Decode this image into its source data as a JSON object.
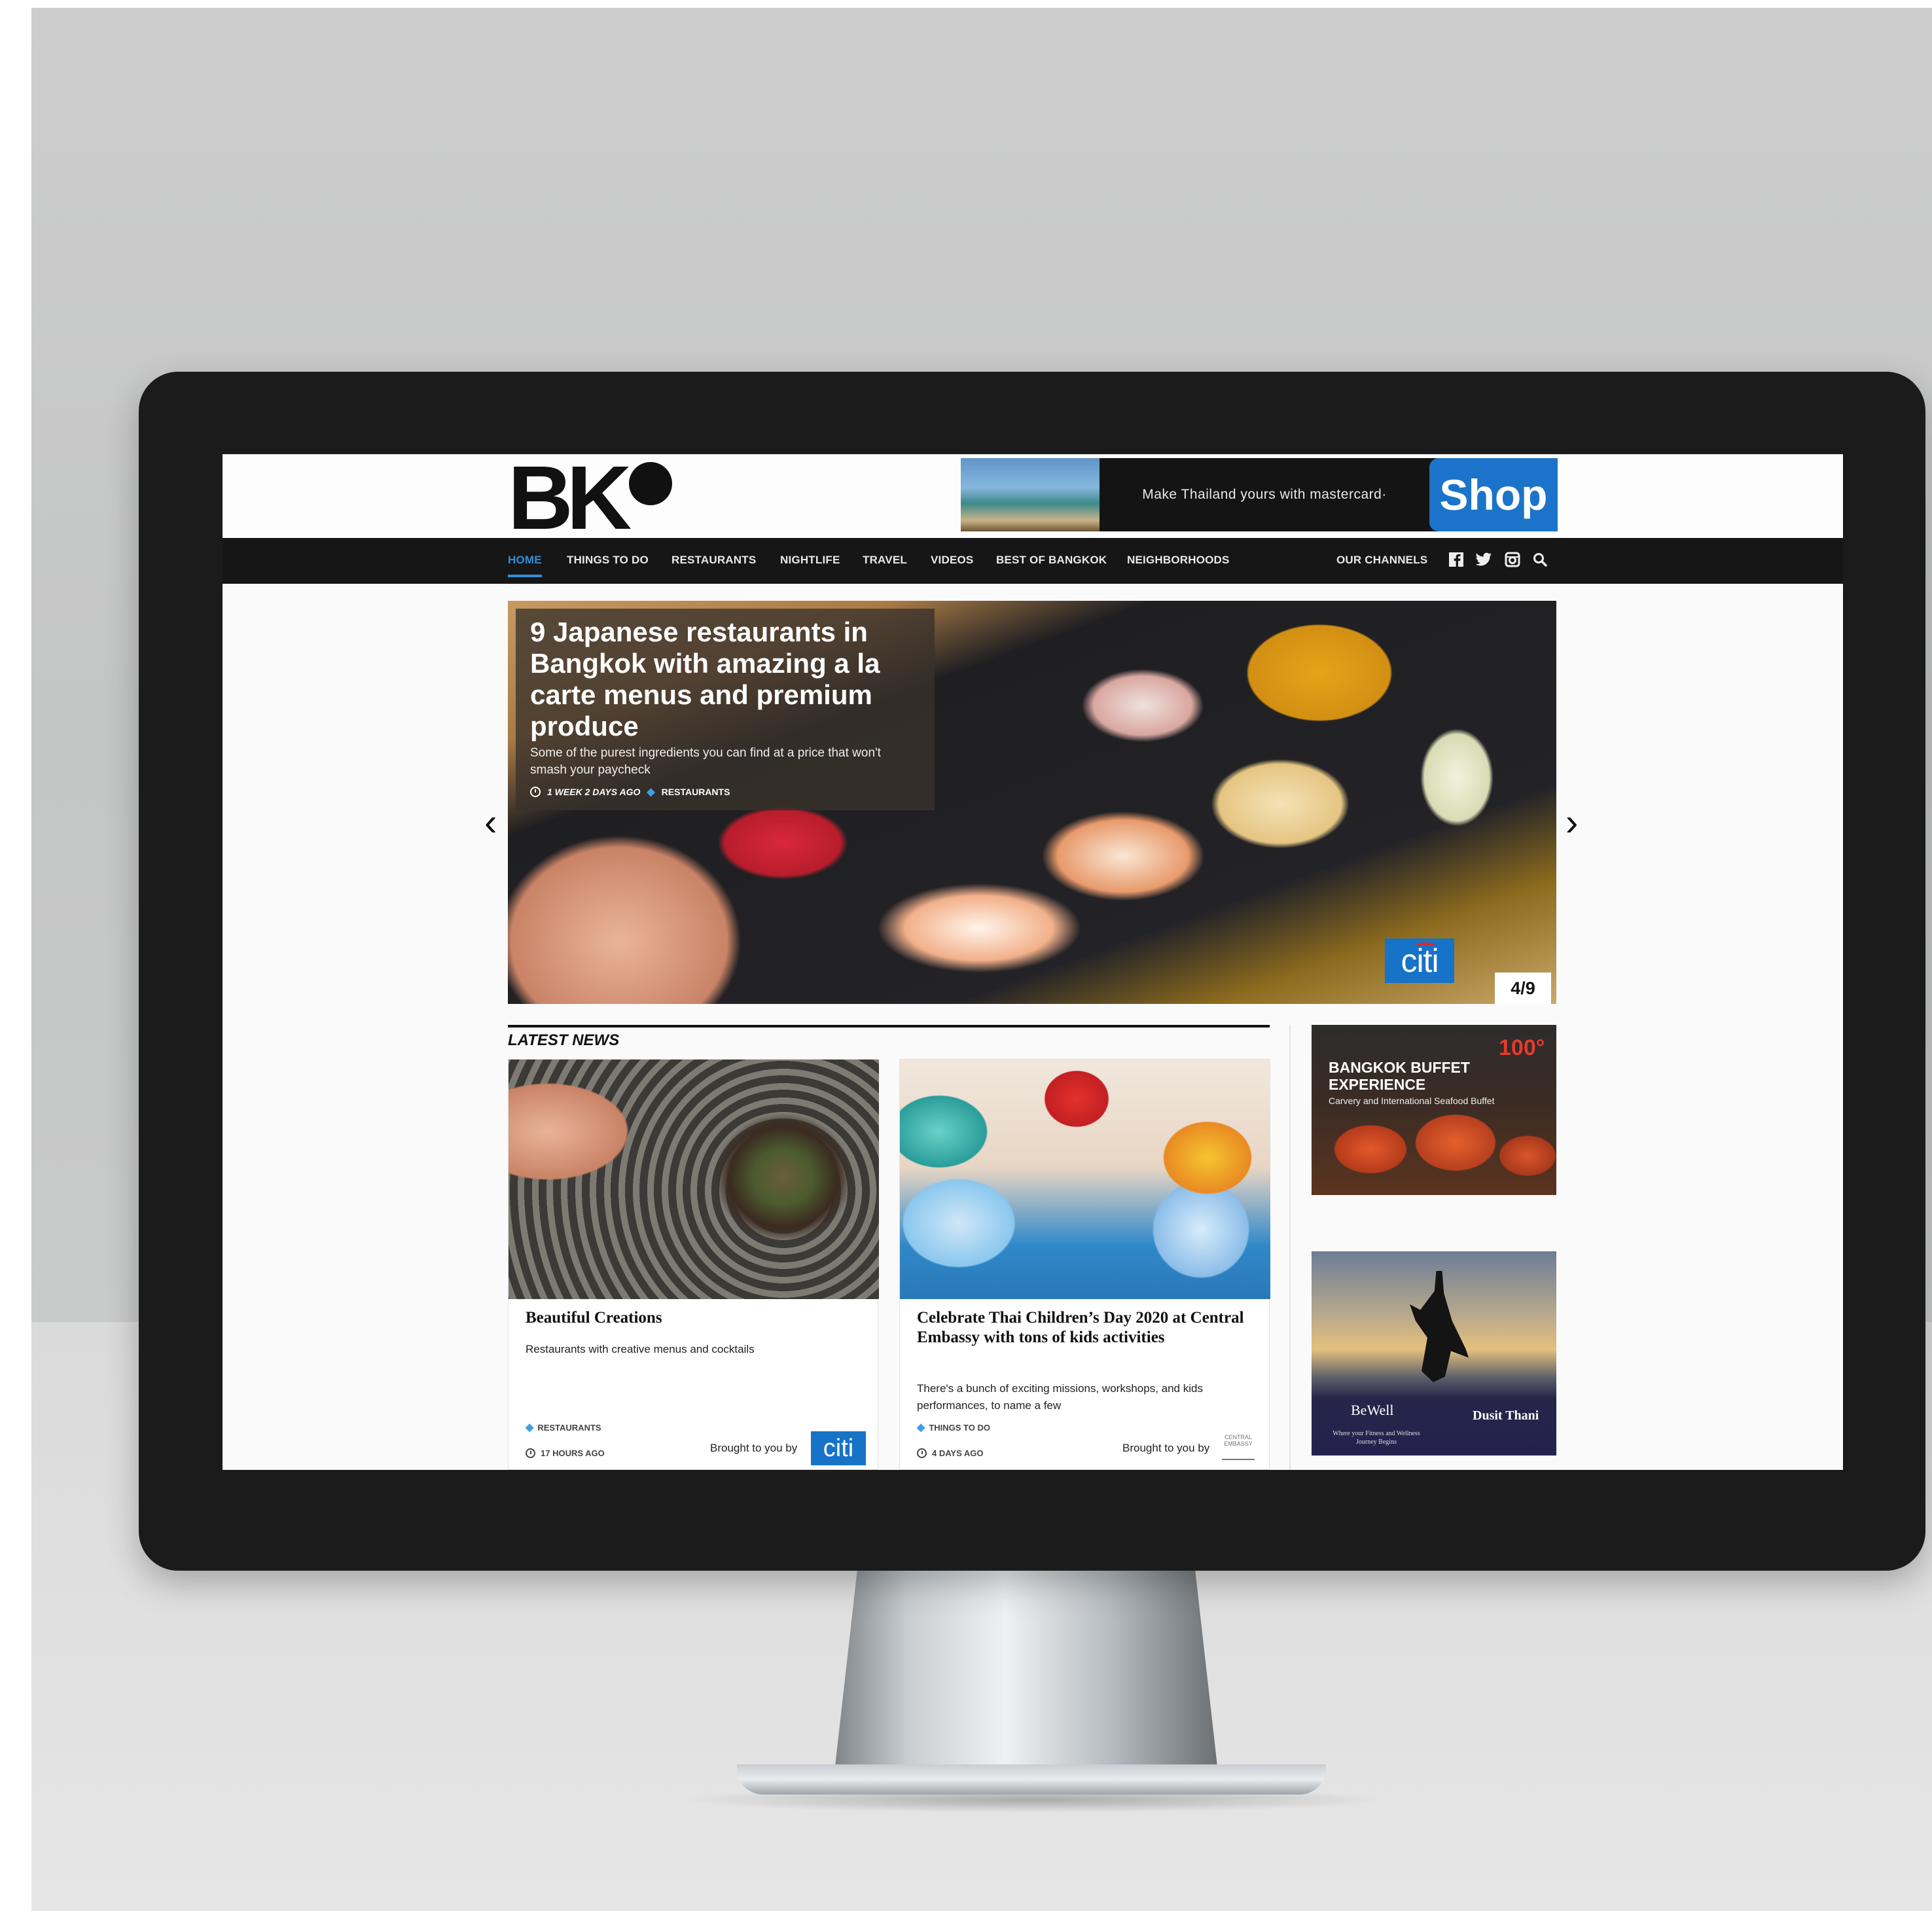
{
  "site": {
    "logo": "BK",
    "top_ad": {
      "text": "Make Thailand yours with mastercard·",
      "cta": "Shop"
    }
  },
  "nav": {
    "items": [
      "HOME",
      "THINGS TO DO",
      "RESTAURANTS",
      "NIGHTLIFE",
      "TRAVEL",
      "VIDEOS",
      "BEST OF BANGKOK",
      "NEIGHBORHOODS"
    ],
    "active": "HOME",
    "channels_label": "OUR CHANNELS",
    "icons": [
      "facebook-icon",
      "twitter-icon",
      "instagram-icon",
      "search-icon"
    ]
  },
  "hero": {
    "title": "9 Japanese restaurants in Bangkok with amazing a la carte menus and premium produce",
    "description": "Some of the purest ingredients you can find at a price that won't smash your paycheck",
    "time": "1 WEEK 2 DAYS AGO",
    "category": "RESTAURANTS",
    "sponsor": "citi",
    "counter": "4/9"
  },
  "latest_news": {
    "heading": "LATEST NEWS",
    "cards": [
      {
        "title": "Beautiful Creations",
        "description": "Restaurants with creative menus and cocktails",
        "category": "RESTAURANTS",
        "time": "17 HOURS AGO",
        "brought_by": "Brought to you by",
        "sponsor": "citi"
      },
      {
        "title": "Celebrate Thai Children’s Day 2020 at Central Embassy with tons of kids activities",
        "description": "There's a bunch of exciting missions, workshops, and kids performances, to name a few",
        "category": "THINGS TO DO",
        "time": "4 DAYS AGO",
        "brought_by": "Brought to you by",
        "sponsor": "CENTRAL EMBASSY"
      }
    ]
  },
  "sidebar": {
    "ad1": {
      "title": "BANGKOK BUFFET EXPERIENCE",
      "subtitle": "Carvery and International Seafood Buffet",
      "badge": "100°"
    },
    "ad2": {
      "brand1": "BeWell",
      "brand1_sub": "Where your Fitness and Wellness Journey Begins",
      "brand2": "Dusit Thani"
    }
  }
}
